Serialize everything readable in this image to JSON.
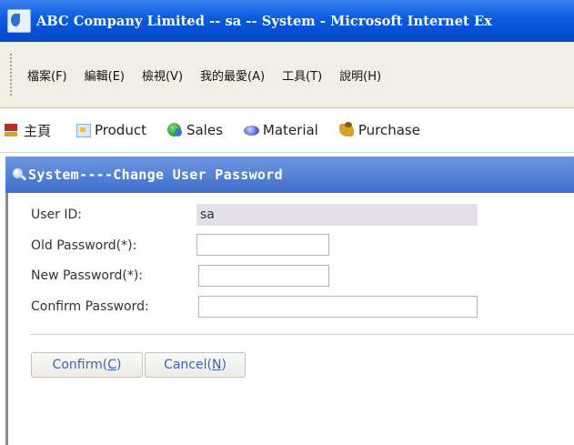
{
  "window": {
    "title": "ABC Company Limited -- sa -- System - Microsoft Internet Ex"
  },
  "menu": {
    "items": [
      "檔案(F)",
      "編輯(E)",
      "檢視(V)",
      "我的最愛(A)",
      "工具(T)",
      "說明(H)"
    ]
  },
  "nav": {
    "items": [
      {
        "label": "主頁",
        "icon": "home-icon"
      },
      {
        "label": "Product",
        "icon": "product-icon"
      },
      {
        "label": "Sales",
        "icon": "sales-icon"
      },
      {
        "label": "Material",
        "icon": "material-icon"
      },
      {
        "label": "Purchase",
        "icon": "purchase-icon"
      }
    ]
  },
  "page": {
    "title": "System----Change User Password"
  },
  "form": {
    "user_id_label": "User ID:",
    "user_id_value": "sa",
    "old_password_label": "Old Password(*):",
    "new_password_label": "New Password(*):",
    "confirm_password_label": "Confirm Password:"
  },
  "buttons": {
    "confirm_text": "Confirm(",
    "confirm_key": "C",
    "confirm_end": ")",
    "cancel_text": "Cancel(",
    "cancel_key": "N",
    "cancel_end": ")"
  },
  "colors": {
    "title_bar": "#0a5ae0",
    "page_header": "#3d6fcd",
    "button_text": "#3b63b9"
  }
}
